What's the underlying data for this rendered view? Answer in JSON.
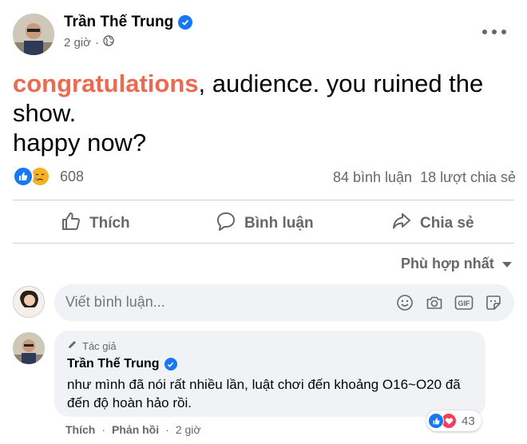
{
  "post": {
    "author": "Trần Thế Trung",
    "time": "2 giờ",
    "privacy_icon": "globe-icon",
    "text_highlight": "congratulations",
    "text_rest": ", audience. you ruined the show.",
    "text_line2": "happy now?"
  },
  "stats": {
    "reaction_icons": [
      "like-icon",
      "care-icon"
    ],
    "reaction_count": "608",
    "comments": "84 bình luận",
    "shares": "18 lượt chia sẻ"
  },
  "actions": {
    "like": "Thích",
    "comment": "Bình luận",
    "share": "Chia sẻ"
  },
  "sort": {
    "label": "Phù hợp nhất"
  },
  "composer": {
    "placeholder": "Viết bình luận...",
    "icons": [
      "emoji-icon",
      "camera-icon",
      "gif-icon",
      "sticker-icon"
    ]
  },
  "comment": {
    "badge": "Tác giả",
    "author": "Trần Thế Trung",
    "text": "như mình đã nói rất nhiều lần, luật chơi đến khoảng O16~O20 đã đến độ hoàn hảo rồi.",
    "reaction_count": "43",
    "like_label": "Thích",
    "reply_label": "Phản hồi",
    "time": "2 giờ"
  },
  "colors": {
    "facebook_blue": "#1877f2",
    "highlight_orange": "#ea6b52",
    "meta_gray": "#65676b",
    "bubble_bg": "#f0f2f5"
  }
}
